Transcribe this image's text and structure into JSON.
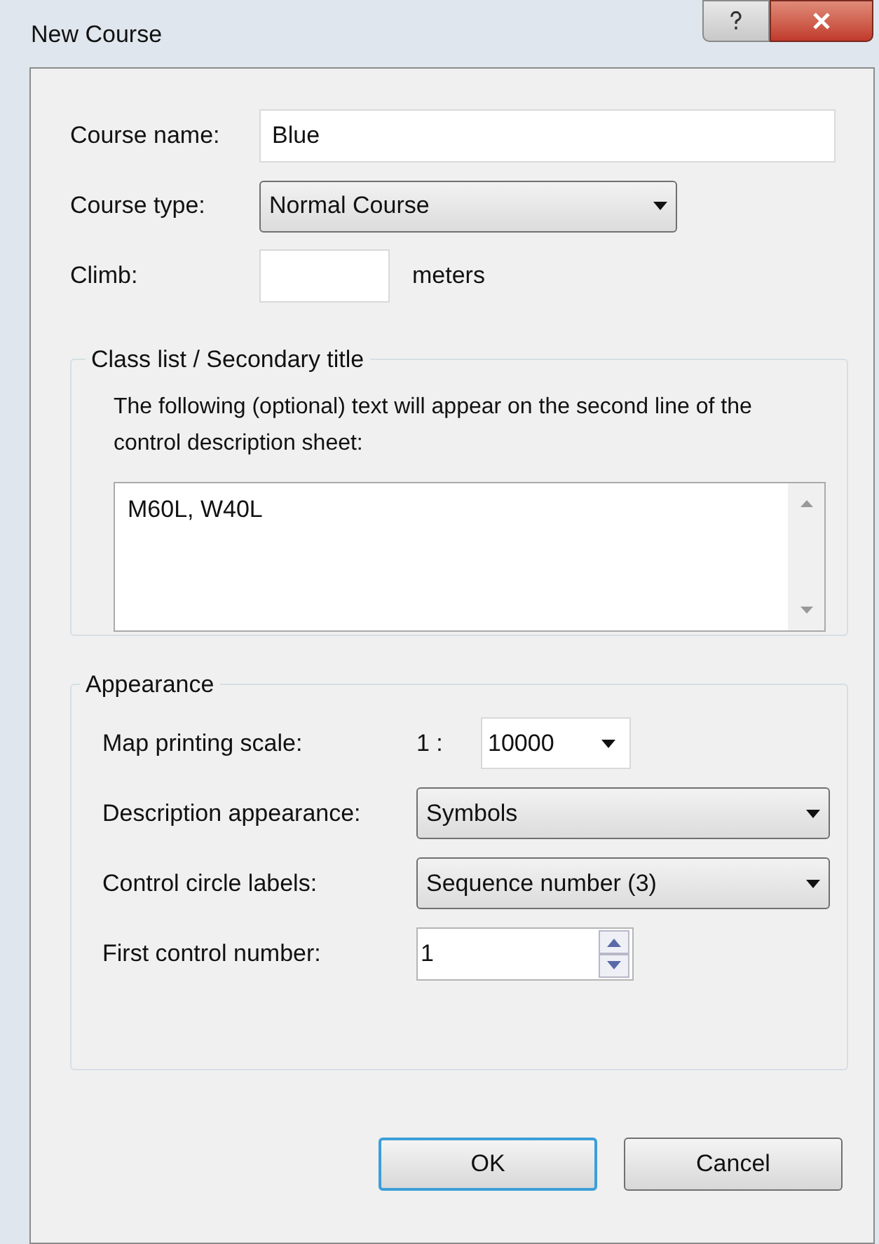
{
  "window": {
    "title": "New Course"
  },
  "fields": [
    {
      "kind": "text",
      "label": "Course name:",
      "value": "Blue"
    },
    {
      "kind": "dropdown",
      "label": "Course type:",
      "value": "Normal Course"
    },
    {
      "kind": "number",
      "label": "Climb:",
      "unit": "meters"
    }
  ],
  "class_list": {
    "title": "Class list / Secondary title",
    "description": "The following (optional) text will appear on the second line of the control description sheet:",
    "value": "M60L, W40L"
  },
  "appearance": {
    "title": "Appearance",
    "fields": [
      {
        "kind": "scale",
        "label": "Map printing scale:",
        "prefix": "1 :",
        "value": "10000"
      },
      {
        "kind": "dropdown",
        "label": "Description appearance:",
        "value": "Symbols"
      },
      {
        "kind": "dropdown",
        "label": "Control circle labels:",
        "value": "Sequence number (3)"
      },
      {
        "kind": "spinner",
        "label": "First control number:",
        "value": "1"
      }
    ]
  },
  "buttons": [
    {
      "label": "OK",
      "default": true
    },
    {
      "label": "Cancel",
      "default": false
    }
  ]
}
